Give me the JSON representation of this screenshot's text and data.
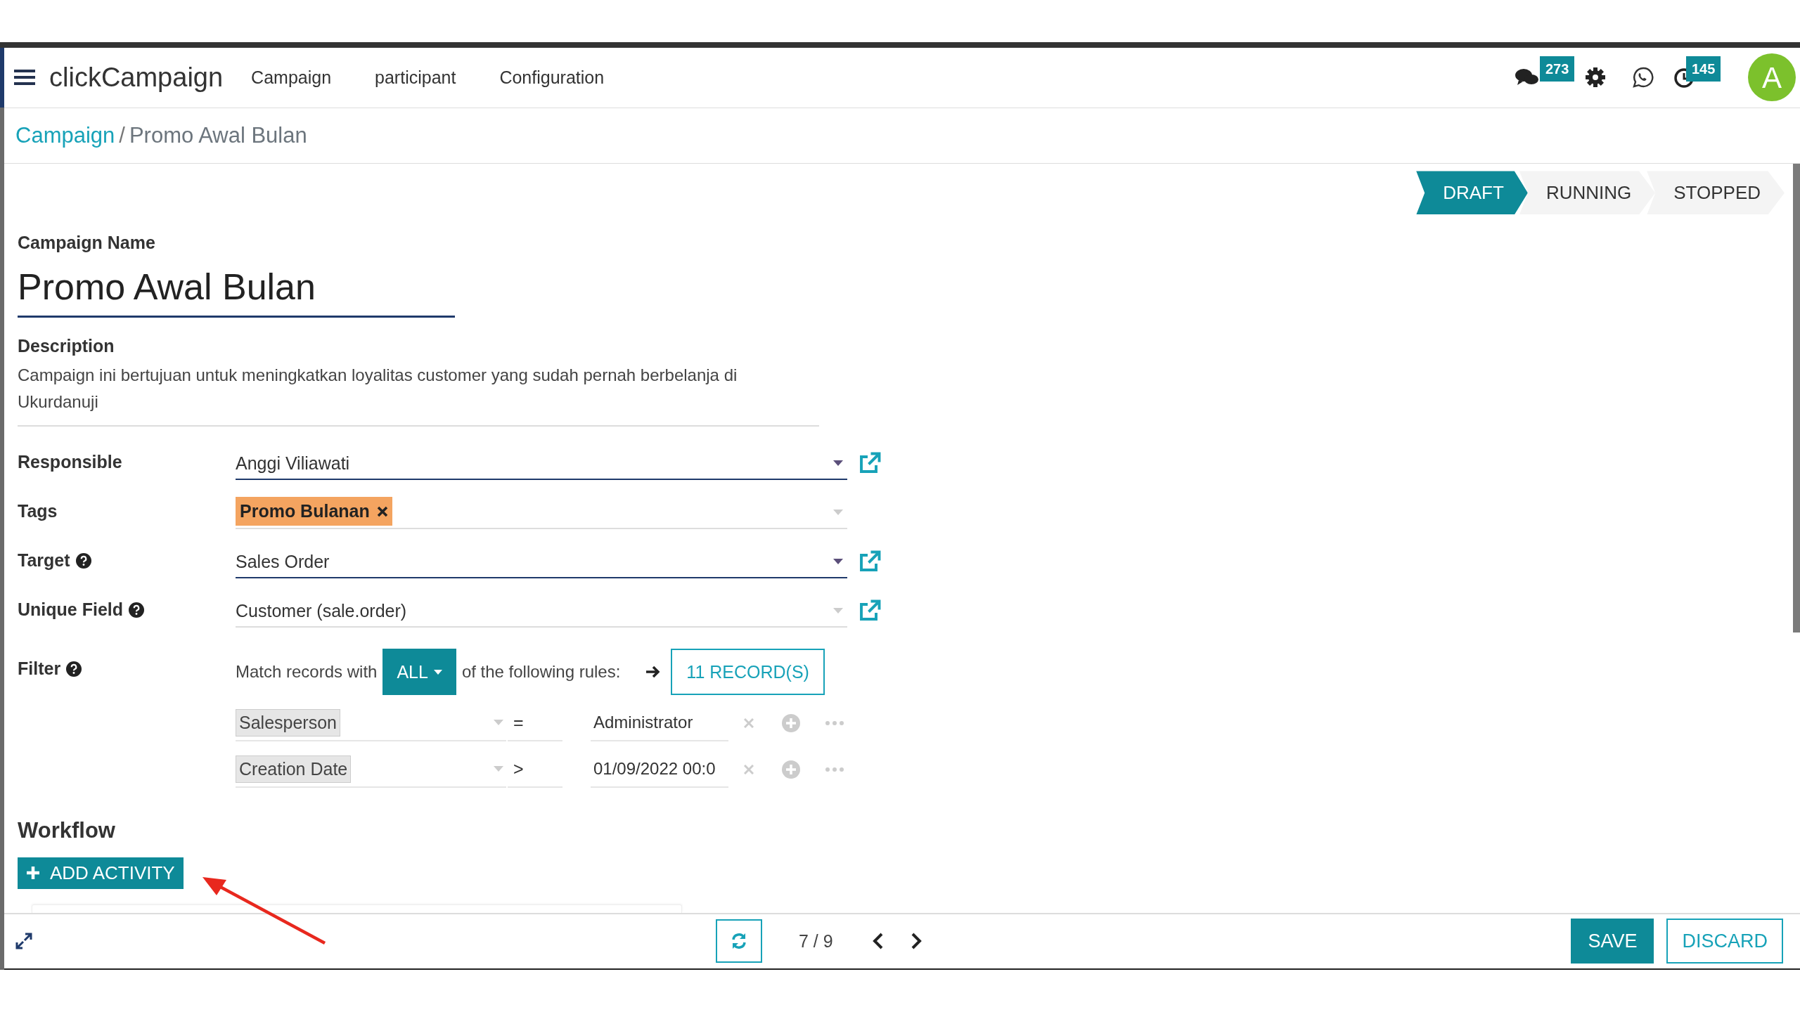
{
  "navbar": {
    "app_title": "clickCampaign",
    "menu": [
      "Campaign",
      "participant",
      "Configuration"
    ],
    "messages_badge": "273",
    "activity_badge": "145",
    "avatar_letter": "A"
  },
  "breadcrumb": [
    {
      "label": "Campaign",
      "kind": "link"
    },
    {
      "label": "/",
      "kind": "separator"
    },
    {
      "label": "Promo Awal Bulan",
      "kind": "current"
    }
  ],
  "statusbar": [
    {
      "label": "DRAFT",
      "selected": true
    },
    {
      "label": "RUNNING",
      "selected": false
    },
    {
      "label": "STOPPED",
      "selected": false
    }
  ],
  "form": {
    "name_label": "Campaign Name",
    "name_value": "Promo Awal Bulan",
    "description_label": "Description",
    "description": "Campaign ini bertujuan untuk meningkatkan loyalitas customer yang sudah pernah berbelanja di Ukurdanuji",
    "fields": [
      {
        "label": "Responsible",
        "kind": "many2one",
        "value": "Anggi Viliawati",
        "help": false,
        "required": true
      },
      {
        "label": "Tags",
        "kind": "tags",
        "tags": [
          {
            "label": "Promo Bulanan",
            "color": "#f4a460"
          }
        ],
        "help": false,
        "required": false
      },
      {
        "label": "Target",
        "kind": "many2one",
        "value": "Sales Order",
        "help": true,
        "required": true
      },
      {
        "label": "Unique Field",
        "kind": "many2one",
        "value": "Customer (sale.order)",
        "help": true,
        "required": false
      }
    ],
    "filter": {
      "label": "Filter",
      "help": true,
      "prefix": "Match records with",
      "mode": "ALL",
      "suffix": "of the following rules:",
      "records": "11 RECORD(S)",
      "rules": [
        {
          "field": "Salesperson",
          "operator": "=",
          "value": "Administrator"
        },
        {
          "field": "Creation Date",
          "operator": ">",
          "value": "01/09/2022 00:0"
        }
      ]
    }
  },
  "workflow": {
    "title": "Workflow",
    "add_button": "ADD ACTIVITY"
  },
  "footer": {
    "pager": "7 / 9",
    "save": "SAVE",
    "discard": "DISCARD"
  }
}
